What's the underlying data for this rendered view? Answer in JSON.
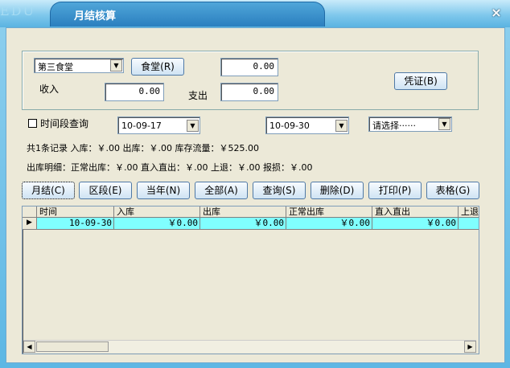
{
  "window": {
    "edu_logo": "EDU",
    "title": "月结核算",
    "close_symbol": "×"
  },
  "top": {
    "canteen_select": "第三食堂",
    "canteen_button": "食堂(R)",
    "top_value": "0.00",
    "income_label": "收入",
    "income_value": "0.00",
    "expense_label": "支出",
    "expense_value": "0.00",
    "voucher_button": "凭证(B)"
  },
  "query": {
    "period_checkbox_label": "时间段查询",
    "period_checked": false,
    "start_date": "10-09-17",
    "end_date": "10-09-30",
    "type_select": "请选择······"
  },
  "summary": {
    "line1": "共1条记录 入库：￥.00  出库：￥.00  库存流量：￥525.00",
    "line2": "出库明细：正常出库：￥.00  直入直出：￥.00  上退：￥.00  报损：￥.00"
  },
  "toolbar": {
    "monthly": "月结(C)",
    "period": "区段(E)",
    "year": "当年(N)",
    "all": "全部(A)",
    "query": "查询(S)",
    "delete": "删除(D)",
    "print": "打印(P)",
    "table": "表格(G)"
  },
  "grid": {
    "columns": [
      "时间",
      "入库",
      "出库",
      "正常出库",
      "直入直出",
      "上退"
    ],
    "rows": [
      [
        "10-09-30",
        "￥0.00",
        "￥0.00",
        "￥0.00",
        "￥0.00",
        ""
      ]
    ]
  },
  "icons": {
    "dropdown": "dropdown-arrow-icon",
    "row_pointer": "row-pointer-icon",
    "scroll_left": "scroll-left-icon",
    "scroll_right": "scroll-right-icon"
  }
}
